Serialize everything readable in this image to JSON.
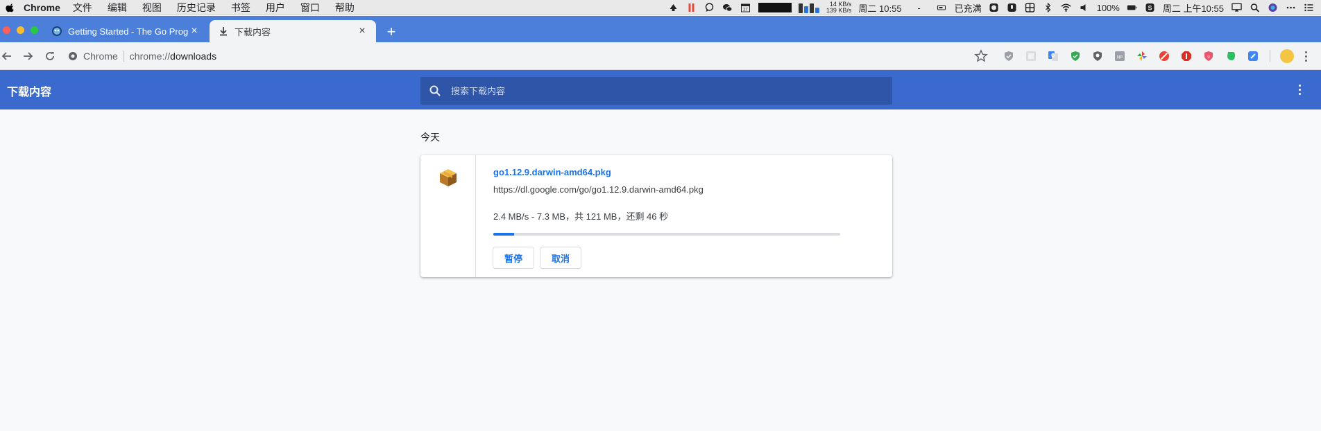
{
  "menubar": {
    "app_name": "Chrome",
    "items": [
      "文件",
      "编辑",
      "视图",
      "历史记录",
      "书签",
      "用户",
      "窗口",
      "帮助"
    ],
    "net_up": "14 KB/s",
    "net_down": "139 KB/s",
    "clock_short": "周二 10:55",
    "dash": "-",
    "charge_status": "已充满",
    "battery_percent": "100%",
    "datetime": "周二 上午10:55",
    "calendar_day": "27"
  },
  "tabs": [
    {
      "title": "Getting Started - The Go Prog",
      "favicon": "go-gopher-icon"
    },
    {
      "title": "下载内容",
      "favicon": "download-icon"
    }
  ],
  "toolbar": {
    "origin_label": "Chrome",
    "url_scheme": "chrome://",
    "url_path": "downloads"
  },
  "downloads": {
    "header_title": "下载内容",
    "search_placeholder": "搜索下载内容",
    "date_label": "今天",
    "items": [
      {
        "file_name": "go1.12.9.darwin-amd64.pkg",
        "url": "https://dl.google.com/go/go1.12.9.darwin-amd64.pkg",
        "status": "2.4 MB/s - 7.3 MB，共 121 MB，还剩 46 秒",
        "progress_fraction": 0.06,
        "pause_label": "暂停",
        "cancel_label": "取消"
      }
    ]
  },
  "colors": {
    "tabstrip": "#4c7fd9",
    "header": "#3b6ace",
    "accent": "#1a73e8"
  }
}
